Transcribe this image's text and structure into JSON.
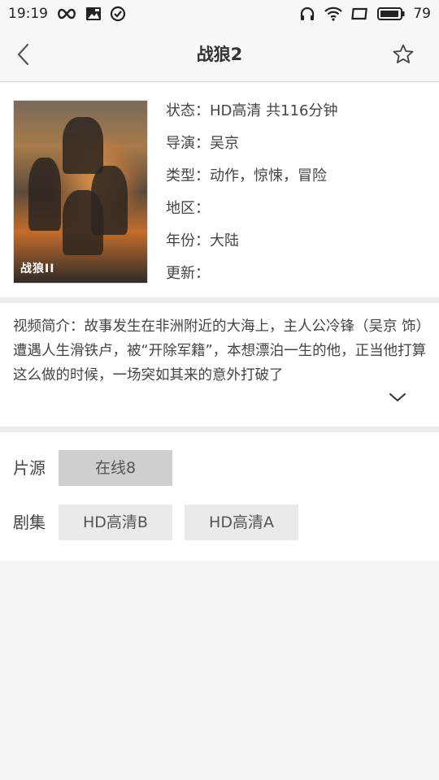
{
  "status_bar": {
    "time": "19:19",
    "battery": "79",
    "icons": [
      "infinity-icon",
      "image-icon",
      "check-circle-icon",
      "headphones-icon",
      "wifi-icon",
      "screen-icon",
      "battery-icon"
    ]
  },
  "header": {
    "title": "战狼2",
    "back_icon": "chevron-left-icon",
    "favorite_icon": "star-outline-icon"
  },
  "movie": {
    "status": "状态：HD高清 共116分钟",
    "director": "导演：吴京",
    "genre": "类型：动作，惊悚，冒险",
    "region": "地区：",
    "year": "年份：大陆",
    "updated": "更新：",
    "poster_text": "战狼II"
  },
  "synopsis": {
    "text": "视频简介：故事发生在非洲附近的大海上，主人公冷锋（吴京 饰）遭遇人生滑铁卢，被“开除军籍”，本想漂泊一生的他，正当他打算这么做的时候，一场突如其来的意外打破了",
    "expand_icon": "chevron-down-icon"
  },
  "sources": {
    "source_label": "片源",
    "source_options": [
      "在线8"
    ],
    "episodes_label": "剧集",
    "episodes": [
      "HD高清B",
      "HD高清A"
    ]
  }
}
